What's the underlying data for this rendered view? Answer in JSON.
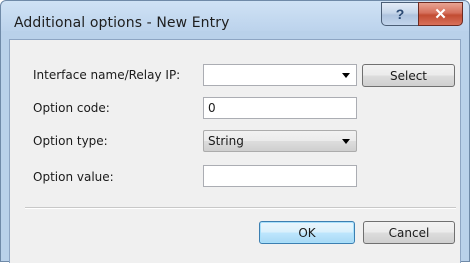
{
  "window": {
    "title": "Additional options - New Entry",
    "help_glyph": "?",
    "close_glyph": "✕"
  },
  "form": {
    "interface": {
      "label": "Interface name/Relay IP:",
      "value": ""
    },
    "select_button": "Select",
    "option_code": {
      "label": "Option code:",
      "value": "0"
    },
    "option_type": {
      "label": "Option type:",
      "value": "String"
    },
    "option_value": {
      "label": "Option value:",
      "value": ""
    }
  },
  "buttons": {
    "ok": "OK",
    "cancel": "Cancel"
  }
}
